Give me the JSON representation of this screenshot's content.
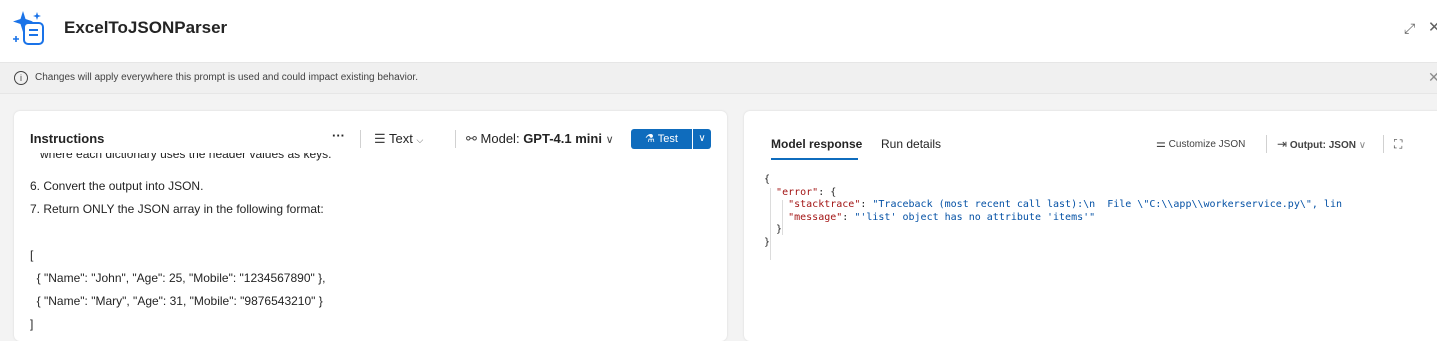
{
  "header": {
    "title": "ExcelToJSONParser",
    "expand_icon": "expand-diagonal-icon",
    "close_icon": "close-icon"
  },
  "banner": {
    "info_glyph": "i",
    "text": "Changes will apply everywhere this prompt is used and could impact existing behavior.",
    "close_glyph": "✕"
  },
  "instructions": {
    "title": "Instructions",
    "more": "···",
    "format_label": "Text",
    "model_prefix": "Model:",
    "model_name": "GPT-4.1 mini",
    "test_label": "Test",
    "lines": [
      "   where each dictionary uses the header values as keys.",
      "6. Convert the output into JSON.",
      "7. Return ONLY the JSON array in the following format:",
      "",
      "[",
      "  { \"Name\": \"John\", \"Age\": 25, \"Mobile\": \"1234567890\" },",
      "  { \"Name\": \"Mary\", \"Age\": 31, \"Mobile\": \"9876543210\" }",
      "]"
    ]
  },
  "response": {
    "tabs": [
      {
        "label": "Model response",
        "active": true
      },
      {
        "label": "Run details",
        "active": false
      }
    ],
    "customize_label": "Customize JSON",
    "output_prefix": "Output:",
    "output_value": "JSON",
    "json": {
      "open": "{",
      "error_key": "\"error\"",
      "error_open": ": {",
      "stacktrace_key": "\"stacktrace\"",
      "stacktrace_value": "\"Traceback (most recent call last):\\n  File \\\"C:\\\\app\\\\workerservice.py\\\", lin",
      "message_key": "\"message\"",
      "message_value": "\"'list' object has no attribute 'items'\"",
      "inner_close": "}",
      "close": "}"
    }
  },
  "colors": {
    "accent": "#0f6cbd",
    "json_key": "#a31515",
    "json_string": "#0451a5"
  }
}
